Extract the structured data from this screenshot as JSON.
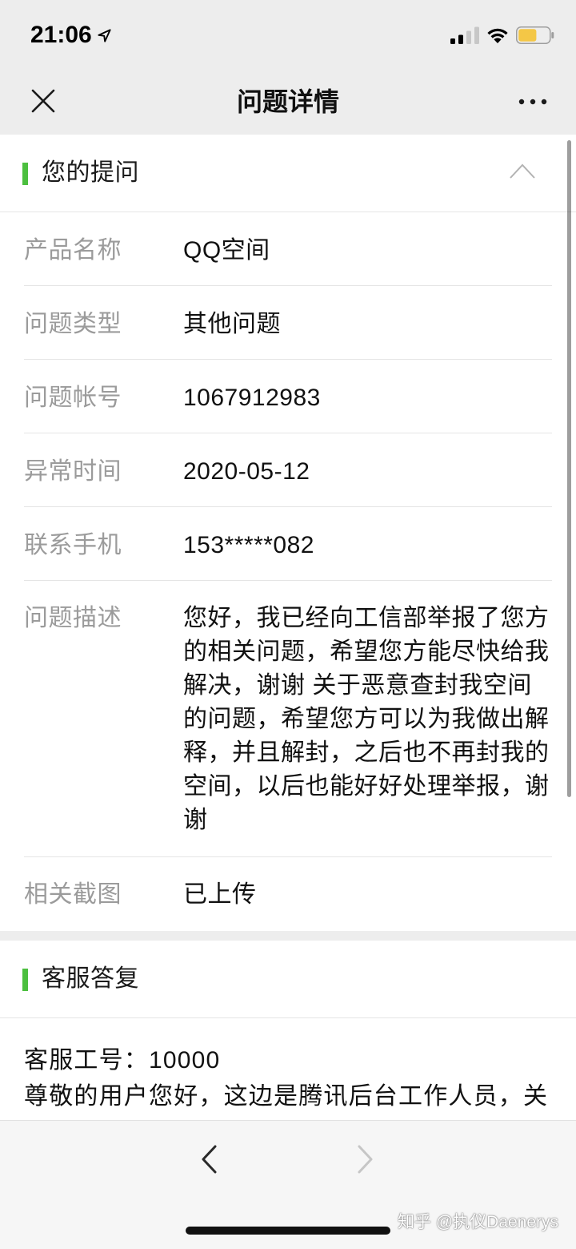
{
  "status_bar": {
    "time": "21:06",
    "icons": [
      "location-arrow-icon",
      "cellular-signal-icon",
      "wifi-icon",
      "battery-icon"
    ],
    "signal_bars_active": 2,
    "signal_bars_total": 4,
    "battery_level": 0.6
  },
  "nav": {
    "title": "问题详情",
    "left_icon": "close-icon",
    "right_icon": "more-icon"
  },
  "question": {
    "header": "您的提问",
    "toggle_icon": "chevron-up-icon",
    "fields": [
      {
        "label": "产品名称",
        "value": "QQ空间"
      },
      {
        "label": "问题类型",
        "value": "其他问题"
      },
      {
        "label": "问题帐号",
        "value": "1067912983"
      },
      {
        "label": "异常时间",
        "value": "2020-05-12"
      },
      {
        "label": "联系手机",
        "value": "153*****082"
      },
      {
        "label": "问题描述",
        "value": "您好，我已经向工信部举报了您方的相关问题，希望您方能尽快给我解决，谢谢 关于恶意查封我空间的问题，希望您方可以为我做出解释，并且解封，之后也不再封我的空间，以后也能好好处理举报，谢谢"
      },
      {
        "label": "相关截图",
        "value": "已上传"
      }
    ]
  },
  "reply": {
    "header": "客服答复",
    "agent_line": "客服工号：10000",
    "body_visible": "尊敬的用户您好，这边是腾讯后台工作人员，关"
  },
  "toolbar": {
    "back_icon": "chevron-left-icon",
    "forward_icon": "chevron-right-icon",
    "forward_enabled": false
  },
  "watermark": "知乎 @执仪Daenerys",
  "colors": {
    "accent": "#4cbf3f",
    "battery": "#f4c746",
    "label": "#9b9b9b",
    "chrome_background": "#ededed"
  }
}
